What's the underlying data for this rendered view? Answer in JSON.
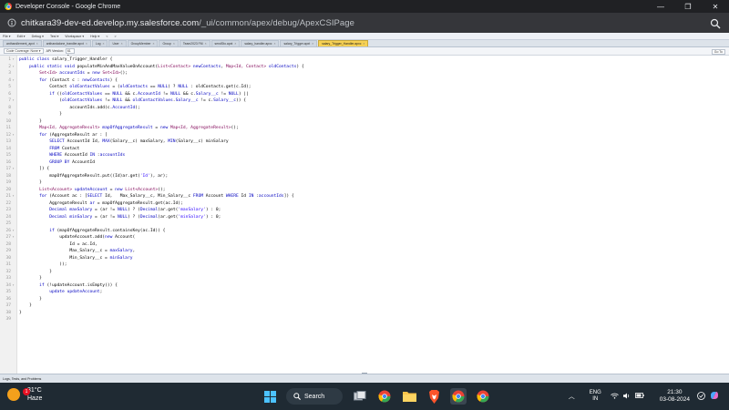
{
  "window": {
    "title": "Developer Console - Google Chrome",
    "controls": {
      "minimize": "—",
      "restore": "❐",
      "close": "✕"
    }
  },
  "address": {
    "url_main": "chitkara39-dev-ed.develop.my.salesforce.com",
    "url_path": "/_ui/common/apex/debug/ApexCSIPage"
  },
  "menubar": [
    "File ▾",
    "Edit ▾",
    "Debug ▾",
    "Test ▾",
    "Workspace ▾",
    "Help ▾",
    "<",
    ">"
  ],
  "tabs": [
    {
      "label": "anthandlement_apxt",
      "active": false
    },
    {
      "label": "anthandalone_trandler.apxt",
      "active": false
    },
    {
      "label": "Log",
      "active": false
    },
    {
      "label": "User",
      "active": false
    },
    {
      "label": "GroupMember",
      "active": false
    },
    {
      "label": "Group",
      "active": false
    },
    {
      "label": "Team2023 FM",
      "active": false
    },
    {
      "label": "sendSto.apxt",
      "active": false
    },
    {
      "label": "salary_handler.apxc",
      "active": false
    },
    {
      "label": "salary_Trigger.apxt",
      "active": false
    },
    {
      "label": "salary_Trigger_Handler.apxc",
      "active": true
    }
  ],
  "toolbar": {
    "coverage": "Code Coverage: None ▾",
    "api_label": "API Version:",
    "api_value": "61 ▾",
    "goto": "Go To"
  },
  "code": {
    "lines": [
      {
        "n": "1",
        "fold": "▾",
        "html": "<span class='kw'>public class</span> salary_Trigger_Handler {"
      },
      {
        "n": "2",
        "fold": "▾",
        "html": "    <span class='kw'>public static void</span> populateMinAndMaxValueOnAccount(<span class='ty'>List&lt;Contact&gt;</span> <span class='vr'>newContacts</span>, <span class='ty'>Map&lt;Id, Contact&gt;</span> <span class='vr'>oldContacts</span>) {"
      },
      {
        "n": "3",
        "fold": "",
        "html": "        <span class='ty'>Set&lt;Id&gt;</span> <span class='vr'>accountIds</span> = <span class='kw'>new</span> <span class='ty'>Set&lt;Id&gt;</span>();"
      },
      {
        "n": "4",
        "fold": "▾",
        "html": "        <span class='kw'>for</span> (Contact c : <span class='vr'>newContacts</span>) {"
      },
      {
        "n": "5",
        "fold": "",
        "html": "            Contact <span class='vr'>oldContactValues</span> = (<span class='vr'>oldContacts</span> == <span class='kw'>NULL</span>) ? <span class='kw'>NULL</span> : oldContacts.get(c.Id);"
      },
      {
        "n": "6",
        "fold": "",
        "html": "            <span class='kw'>if</span> ((<span class='vr'>oldContactValues</span> == <span class='kw'>NULL</span> &amp;&amp; c.<span class='vr'>AccountId</span> != <span class='kw'>NULL</span> &amp;&amp; c.<span class='vr'>Salary__c</span> != <span class='kw'>NULL</span>) ||"
      },
      {
        "n": "7",
        "fold": "▾",
        "html": "                (<span class='vr'>oldContactValues</span> != <span class='kw'>NULL</span> &amp;&amp; <span class='vr'>oldContactValues</span>.<span class='vr'>Salary__c</span> != c.<span class='vr'>Salary__c</span>)) {"
      },
      {
        "n": "8",
        "fold": "",
        "html": "                    accountIds.add(c.<span class='vr'>AccountId</span>);"
      },
      {
        "n": "9",
        "fold": "",
        "html": "                }"
      },
      {
        "n": "10",
        "fold": "",
        "html": "        }"
      },
      {
        "n": "11",
        "fold": "",
        "html": "        <span class='ty'>Map&lt;Id, AggregateResult&gt;</span> <span class='vr'>mapOfAggregateResult</span> = <span class='kw'>new</span> <span class='ty'>Map&lt;Id, AggregateResult&gt;</span>();"
      },
      {
        "n": "12",
        "fold": "▾",
        "html": "        <span class='kw'>for</span> (AggregateResult ar : ["
      },
      {
        "n": "13",
        "fold": "",
        "html": "            <span class='kw'>SELECT</span> AccountId Id, <span class='kw'>MAX</span>(Salary__c) maxSalary, <span class='kw'>MIN</span>(Salary__c) minSalary"
      },
      {
        "n": "14",
        "fold": "",
        "html": "            <span class='kw'>FROM</span> Contact"
      },
      {
        "n": "15",
        "fold": "",
        "html": "            <span class='kw'>WHERE</span> AccountId <span class='kw'>IN</span> :<span class='vr'>accountIds</span>"
      },
      {
        "n": "16",
        "fold": "",
        "html": "            <span class='kw'>GROUP BY</span> AccountId"
      },
      {
        "n": "17",
        "fold": "▾",
        "html": "        ]) {"
      },
      {
        "n": "18",
        "fold": "",
        "html": "            mapOfAggregateResult.put((Id)ar.get(<span class='st'>'Id'</span>), ar);"
      },
      {
        "n": "19",
        "fold": "",
        "html": "        }"
      },
      {
        "n": "20",
        "fold": "",
        "html": "        <span class='ty'>List&lt;Account&gt;</span> <span class='vr'>updateAccount</span> = <span class='kw'>new</span> <span class='ty'>List&lt;Account&gt;</span>();"
      },
      {
        "n": "21",
        "fold": "▾",
        "html": "        <span class='kw'>for</span> (Account ac : [<span class='kw'>SELECT</span> Id,   Max_Salary__c, Min_Salary__c <span class='kw'>FROM</span> Account <span class='kw'>WHERE</span> Id <span class='kw'>IN</span> :<span class='vr'>accountIds</span>]) {"
      },
      {
        "n": "22",
        "fold": "",
        "html": "            AggregateResult <span class='vr'>ar</span> = mapOfAggregateResult.get(ac.Id);"
      },
      {
        "n": "23",
        "fold": "",
        "html": "            <span class='kw'>Decimal</span> <span class='vr'>maxSalary</span> = (ar != <span class='kw'>NULL</span>) ? (<span class='kw'>Decimal</span>)ar.get(<span class='st'>'maxSalary'</span>) : 0;"
      },
      {
        "n": "24",
        "fold": "",
        "html": "            <span class='kw'>Decimal</span> <span class='vr'>minSalary</span> = (ar != <span class='kw'>NULL</span>) ? (<span class='kw'>Decimal</span>)ar.get(<span class='st'>'minSalary'</span>) : 0;"
      },
      {
        "n": "25",
        "fold": "",
        "html": ""
      },
      {
        "n": "26",
        "fold": "▾",
        "html": "            <span class='kw'>if</span> (mapOfAggregateResult.containsKey(ac.Id)) {"
      },
      {
        "n": "27",
        "fold": "▾",
        "html": "                updateAccount.add(<span class='kw'>new</span> Account("
      },
      {
        "n": "28",
        "fold": "",
        "html": "                    Id = ac.Id,"
      },
      {
        "n": "29",
        "fold": "",
        "html": "                    Max_Salary__c = <span class='vr'>maxSalary</span>,"
      },
      {
        "n": "30",
        "fold": "",
        "html": "                    Min_Salary__c = <span class='vr'>minSalary</span>"
      },
      {
        "n": "31",
        "fold": "",
        "html": "                ));"
      },
      {
        "n": "32",
        "fold": "",
        "html": "            }"
      },
      {
        "n": "33",
        "fold": "",
        "html": "        }"
      },
      {
        "n": "34",
        "fold": "▾",
        "html": "        <span class='kw'>if</span> (!updateAccount.isEmpty()) {"
      },
      {
        "n": "35",
        "fold": "",
        "html": "            <span class='kw'>update</span> <span class='vr'>updateAccount</span>;"
      },
      {
        "n": "36",
        "fold": "",
        "html": "        }"
      },
      {
        "n": "37",
        "fold": "",
        "html": "    }"
      },
      {
        "n": "38",
        "fold": "",
        "html": "}"
      },
      {
        "n": "39",
        "fold": "",
        "html": ""
      }
    ]
  },
  "logs_panel": {
    "label": "Logs, Tests, and Problems"
  },
  "taskbar": {
    "weather_temp": "31°C",
    "weather_desc": "Haze",
    "weather_badge": "1",
    "search_label": "Search",
    "lang_1": "ENG",
    "lang_2": "IN",
    "time": "21:30",
    "date": "03-08-2024",
    "tray_arrow": "︿"
  },
  "colors": {
    "chrome_dark": "#202124",
    "address_bar": "#35363a",
    "active_tab": "#f7d154",
    "taskbar": "#1f2a33"
  }
}
